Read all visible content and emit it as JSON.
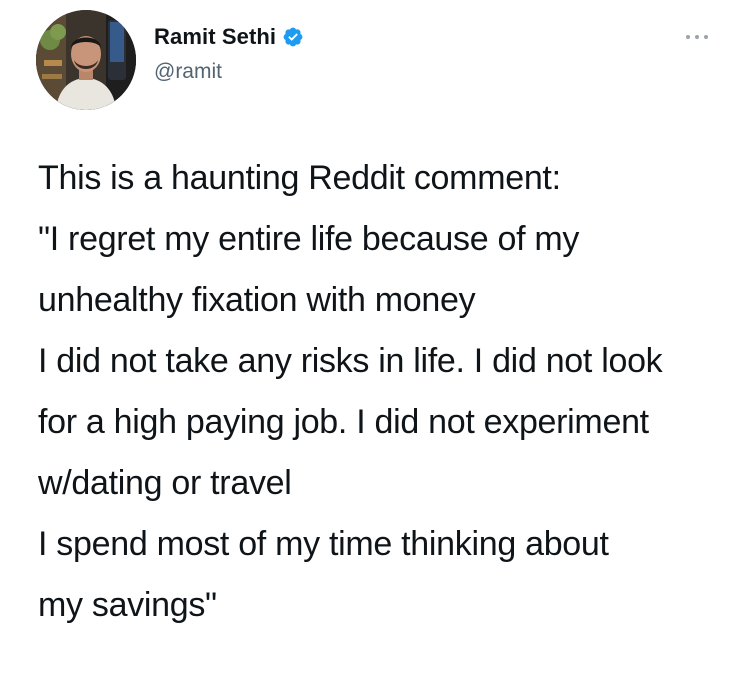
{
  "author": {
    "display_name": "Ramit Sethi",
    "handle": "@ramit",
    "verified": true,
    "avatar_icon": "profile-photo"
  },
  "actions": {
    "more_icon": "more-dots-icon"
  },
  "tweet": {
    "paragraphs": [
      "This is a haunting Reddit comment:",
      "\"I regret my entire life because of my unhealthy fixation with money",
      "I did not take any risks in life. I did not look for a high paying job. I did not experiment w/dating or travel",
      "I spend most of my time thinking about my savings\""
    ]
  },
  "colors": {
    "text": "#0f1419",
    "secondary_text": "#536471",
    "verified_badge": "#1d9bf0",
    "background": "#ffffff"
  }
}
